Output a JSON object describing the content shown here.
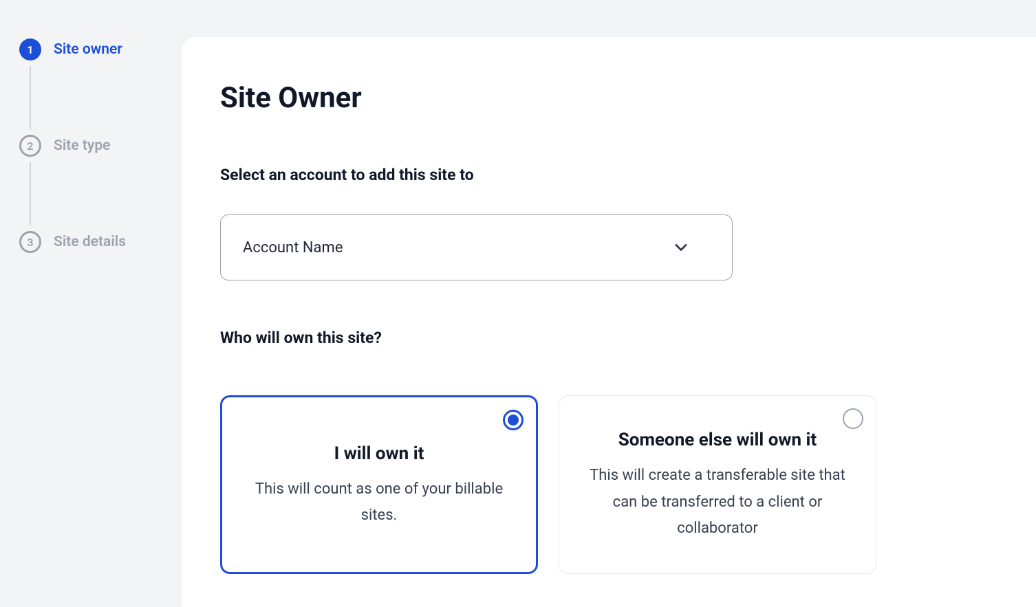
{
  "stepper": {
    "steps": [
      {
        "num": "1",
        "label": "Site owner"
      },
      {
        "num": "2",
        "label": "Site type"
      },
      {
        "num": "3",
        "label": "Site details"
      }
    ]
  },
  "page": {
    "title": "Site Owner"
  },
  "account_section": {
    "label": "Select an account to add this site to",
    "selected": "Account Name"
  },
  "owner_section": {
    "label": "Who will own this site?",
    "options": [
      {
        "title": "I will own it",
        "desc": "This will count as one of your billable sites."
      },
      {
        "title": "Someone else will own it",
        "desc": "This will create a transferable site that can be transferred to a client or collaborator"
      }
    ]
  }
}
